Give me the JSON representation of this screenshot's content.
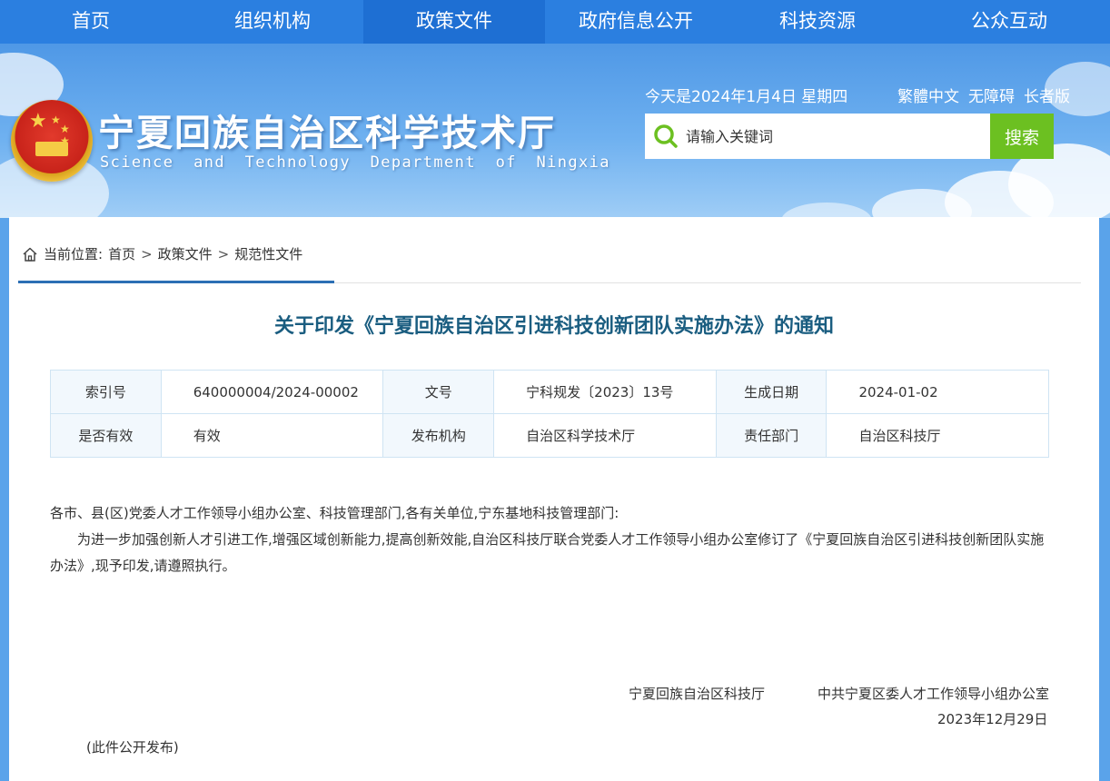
{
  "nav": {
    "items": [
      "首页",
      "组织机构",
      "政策文件",
      "政府信息公开",
      "科技资源",
      "公众互动"
    ],
    "active_index": 2
  },
  "header": {
    "title": "宁夏回族自治区科学技术厅",
    "subtitle": "Science and Technology Department of Ningxia",
    "today": "今天是2024年1月4日 星期四",
    "tools": [
      "繁體中文",
      "无障碍",
      "长者版"
    ],
    "search_placeholder": "请输入关键词",
    "search_button": "搜索",
    "emblem_icon": "national-emblem-icon"
  },
  "breadcrumb": {
    "label": "当前位置:",
    "items": [
      "首页",
      "政策文件",
      "规范性文件"
    ],
    "separator": ">"
  },
  "document": {
    "title": "关于印发《宁夏回族自治区引进科技创新团队实施办法》的通知",
    "meta": [
      [
        {
          "k": "索引号",
          "v": "640000004/2024-00002"
        },
        {
          "k": "文号",
          "v": "宁科规发〔2023〕13号"
        },
        {
          "k": "生成日期",
          "v": "2024-01-02"
        }
      ],
      [
        {
          "k": "是否有效",
          "v": "有效"
        },
        {
          "k": "发布机构",
          "v": "自治区科学技术厅"
        },
        {
          "k": "责任部门",
          "v": "自治区科技厅"
        }
      ]
    ],
    "salutation": "各市、县(区)党委人才工作领导小组办公室、科技管理部门,各有关单位,宁东基地科技管理部门:",
    "paragraph": "为进一步加强创新人才引进工作,增强区域创新能力,提高创新效能,自治区科技厅联合党委人才工作领导小组办公室修订了《宁夏回族自治区引进科技创新团队实施办法》,现予印发,请遵照执行。",
    "signatory_1": "宁夏回族自治区科技厅",
    "signatory_2": "中共宁夏区委人才工作领导小组办公室",
    "date": "2023年12月29日",
    "footnote": "(此件公开发布)"
  },
  "colors": {
    "nav_bg": "#2b7fe0",
    "nav_active": "#1e6fd3",
    "search_button": "#6cc021",
    "title_color": "#1a5d80",
    "accent_line": "#2b6fb4"
  }
}
